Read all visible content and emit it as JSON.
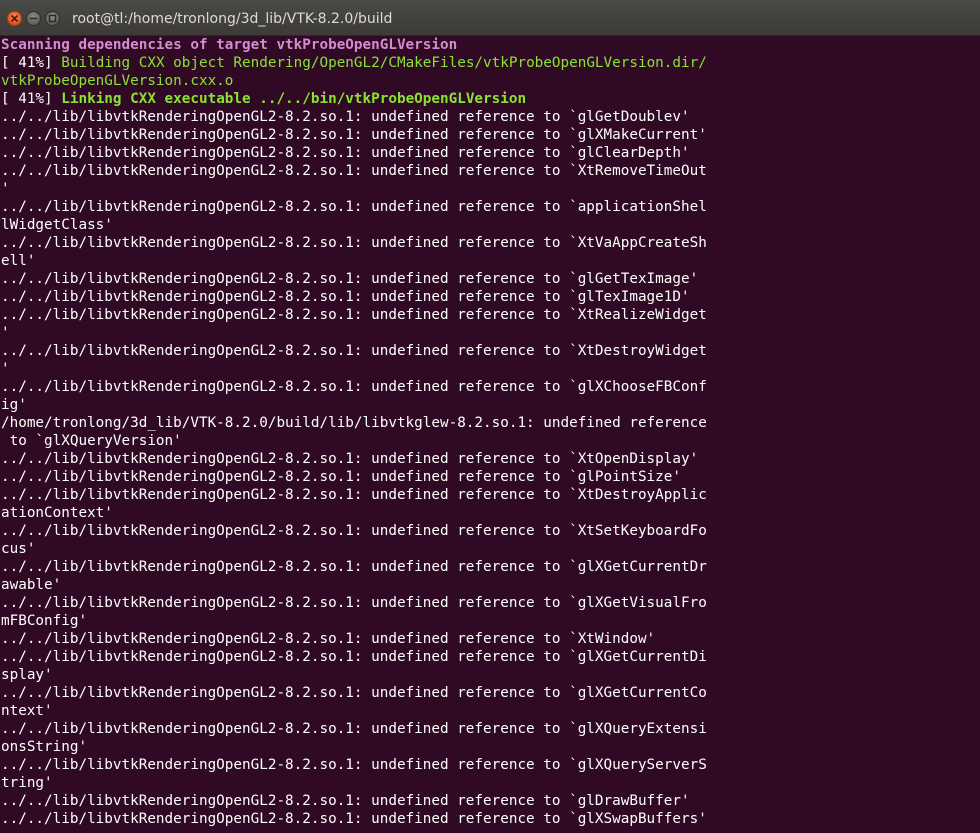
{
  "window": {
    "title": "root@tl:/home/tronlong/3d_lib/VTK-8.2.0/build"
  },
  "terminal": {
    "lines": [
      {
        "segments": [
          {
            "text": "Scanning dependencies of target vtkProbeOpenGLVersion",
            "style": "purple"
          }
        ]
      },
      {
        "segments": [
          {
            "text": "[ 41%] ",
            "style": "white"
          },
          {
            "text": "Building CXX object Rendering/OpenGL2/CMakeFiles/vtkProbeOpenGLVersion.dir/",
            "style": "green"
          }
        ]
      },
      {
        "segments": [
          {
            "text": "vtkProbeOpenGLVersion.cxx.o",
            "style": "green"
          }
        ]
      },
      {
        "segments": [
          {
            "text": "[ 41%] ",
            "style": "white"
          },
          {
            "text": "Linking CXX executable ../../bin/vtkProbeOpenGLVersion",
            "style": "green-bold"
          }
        ]
      },
      {
        "segments": [
          {
            "text": "../../lib/libvtkRenderingOpenGL2-8.2.so.1: undefined reference to `glGetDoublev'",
            "style": "white"
          }
        ]
      },
      {
        "segments": [
          {
            "text": "../../lib/libvtkRenderingOpenGL2-8.2.so.1: undefined reference to `glXMakeCurrent'",
            "style": "white"
          }
        ]
      },
      {
        "segments": [
          {
            "text": "../../lib/libvtkRenderingOpenGL2-8.2.so.1: undefined reference to `glClearDepth'",
            "style": "white"
          }
        ]
      },
      {
        "segments": [
          {
            "text": "../../lib/libvtkRenderingOpenGL2-8.2.so.1: undefined reference to `XtRemoveTimeOut",
            "style": "white"
          }
        ]
      },
      {
        "segments": [
          {
            "text": "'",
            "style": "white"
          }
        ]
      },
      {
        "segments": [
          {
            "text": "../../lib/libvtkRenderingOpenGL2-8.2.so.1: undefined reference to `applicationShel",
            "style": "white"
          }
        ]
      },
      {
        "segments": [
          {
            "text": "lWidgetClass'",
            "style": "white"
          }
        ]
      },
      {
        "segments": [
          {
            "text": "../../lib/libvtkRenderingOpenGL2-8.2.so.1: undefined reference to `XtVaAppCreateSh",
            "style": "white"
          }
        ]
      },
      {
        "segments": [
          {
            "text": "ell'",
            "style": "white"
          }
        ]
      },
      {
        "segments": [
          {
            "text": "../../lib/libvtkRenderingOpenGL2-8.2.so.1: undefined reference to `glGetTexImage'",
            "style": "white"
          }
        ]
      },
      {
        "segments": [
          {
            "text": "../../lib/libvtkRenderingOpenGL2-8.2.so.1: undefined reference to `glTexImage1D'",
            "style": "white"
          }
        ]
      },
      {
        "segments": [
          {
            "text": "../../lib/libvtkRenderingOpenGL2-8.2.so.1: undefined reference to `XtRealizeWidget",
            "style": "white"
          }
        ]
      },
      {
        "segments": [
          {
            "text": "'",
            "style": "white"
          }
        ]
      },
      {
        "segments": [
          {
            "text": "../../lib/libvtkRenderingOpenGL2-8.2.so.1: undefined reference to `XtDestroyWidget",
            "style": "white"
          }
        ]
      },
      {
        "segments": [
          {
            "text": "'",
            "style": "white"
          }
        ]
      },
      {
        "segments": [
          {
            "text": "../../lib/libvtkRenderingOpenGL2-8.2.so.1: undefined reference to `glXChooseFBConf",
            "style": "white"
          }
        ]
      },
      {
        "segments": [
          {
            "text": "ig'",
            "style": "white"
          }
        ]
      },
      {
        "segments": [
          {
            "text": "/home/tronlong/3d_lib/VTK-8.2.0/build/lib/libvtkglew-8.2.so.1: undefined reference",
            "style": "white"
          }
        ]
      },
      {
        "segments": [
          {
            "text": " to `glXQueryVersion'",
            "style": "white"
          }
        ]
      },
      {
        "segments": [
          {
            "text": "../../lib/libvtkRenderingOpenGL2-8.2.so.1: undefined reference to `XtOpenDisplay'",
            "style": "white"
          }
        ]
      },
      {
        "segments": [
          {
            "text": "../../lib/libvtkRenderingOpenGL2-8.2.so.1: undefined reference to `glPointSize'",
            "style": "white"
          }
        ]
      },
      {
        "segments": [
          {
            "text": "../../lib/libvtkRenderingOpenGL2-8.2.so.1: undefined reference to `XtDestroyApplic",
            "style": "white"
          }
        ]
      },
      {
        "segments": [
          {
            "text": "ationContext'",
            "style": "white"
          }
        ]
      },
      {
        "segments": [
          {
            "text": "../../lib/libvtkRenderingOpenGL2-8.2.so.1: undefined reference to `XtSetKeyboardFo",
            "style": "white"
          }
        ]
      },
      {
        "segments": [
          {
            "text": "cus'",
            "style": "white"
          }
        ]
      },
      {
        "segments": [
          {
            "text": "../../lib/libvtkRenderingOpenGL2-8.2.so.1: undefined reference to `glXGetCurrentDr",
            "style": "white"
          }
        ]
      },
      {
        "segments": [
          {
            "text": "awable'",
            "style": "white"
          }
        ]
      },
      {
        "segments": [
          {
            "text": "../../lib/libvtkRenderingOpenGL2-8.2.so.1: undefined reference to `glXGetVisualFro",
            "style": "white"
          }
        ]
      },
      {
        "segments": [
          {
            "text": "mFBConfig'",
            "style": "white"
          }
        ]
      },
      {
        "segments": [
          {
            "text": "../../lib/libvtkRenderingOpenGL2-8.2.so.1: undefined reference to `XtWindow'",
            "style": "white"
          }
        ]
      },
      {
        "segments": [
          {
            "text": "../../lib/libvtkRenderingOpenGL2-8.2.so.1: undefined reference to `glXGetCurrentDi",
            "style": "white"
          }
        ]
      },
      {
        "segments": [
          {
            "text": "splay'",
            "style": "white"
          }
        ]
      },
      {
        "segments": [
          {
            "text": "../../lib/libvtkRenderingOpenGL2-8.2.so.1: undefined reference to `glXGetCurrentCo",
            "style": "white"
          }
        ]
      },
      {
        "segments": [
          {
            "text": "ntext'",
            "style": "white"
          }
        ]
      },
      {
        "segments": [
          {
            "text": "../../lib/libvtkRenderingOpenGL2-8.2.so.1: undefined reference to `glXQueryExtensi",
            "style": "white"
          }
        ]
      },
      {
        "segments": [
          {
            "text": "onsString'",
            "style": "white"
          }
        ]
      },
      {
        "segments": [
          {
            "text": "../../lib/libvtkRenderingOpenGL2-8.2.so.1: undefined reference to `glXQueryServerS",
            "style": "white"
          }
        ]
      },
      {
        "segments": [
          {
            "text": "tring'",
            "style": "white"
          }
        ]
      },
      {
        "segments": [
          {
            "text": "../../lib/libvtkRenderingOpenGL2-8.2.so.1: undefined reference to `glDrawBuffer'",
            "style": "white"
          }
        ]
      },
      {
        "segments": [
          {
            "text": "../../lib/libvtkRenderingOpenGL2-8.2.so.1: undefined reference to `glXSwapBuffers'",
            "style": "white"
          }
        ]
      }
    ]
  }
}
